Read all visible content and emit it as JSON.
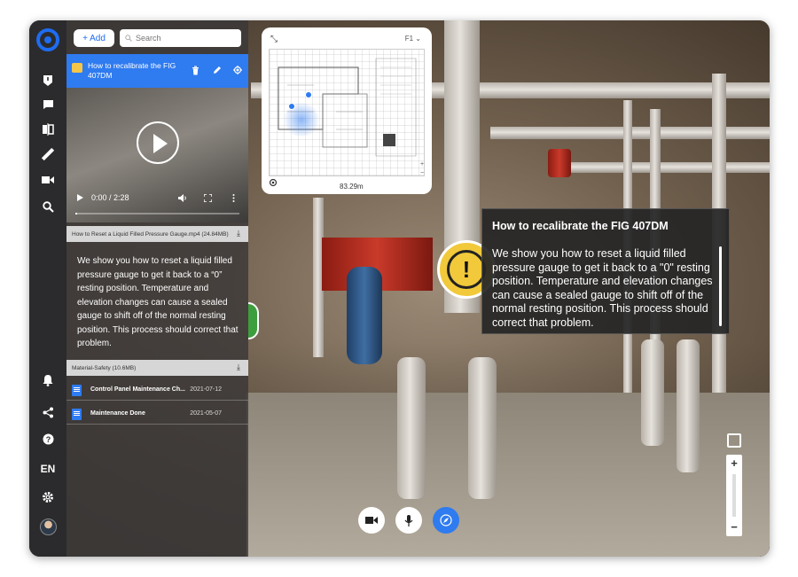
{
  "sidebar": {
    "icons": [
      "tag-icon",
      "comment-icon",
      "compare-icon",
      "measure-icon",
      "video-icon",
      "search-icon",
      "bell-icon",
      "share-icon",
      "help-icon",
      "settings-icon"
    ],
    "language": "EN"
  },
  "panel": {
    "add_label": "+ Add",
    "search_placeholder": "Search",
    "selected_tag_title": "How to recalibrate the FIG 407DM",
    "video": {
      "time": "0:00 / 2:28",
      "progress_fraction": 0.0
    },
    "video_file": "How to Reset a Liquid Filled Pressure Gauge.mp4 (24.84MB)",
    "description": "We show you how to reset a liquid filled pressure gauge to get it back to a “0” resting position. Temperature and elevation changes can cause a sealed gauge to shift off of the normal resting position. This process should correct that problem.",
    "attachment_file": "Material-Safety (10.6MB)",
    "documents": [
      {
        "name": "Control Panel Maintenance Ch...",
        "date": "2021-07-12"
      },
      {
        "name": "Maintenance Done",
        "date": "2021-05-07"
      }
    ]
  },
  "minimap": {
    "floor": "F1",
    "scale": "83.29m"
  },
  "tooltip": {
    "title": "How to recalibrate the FIG 407DM",
    "body": "We show you how to reset a liquid filled pressure gauge to get it back to a \"0\" resting position. Temperature and elevation changes can cause a sealed gauge to shift off of the normal resting position. This process should correct that problem."
  },
  "colors": {
    "accent": "#2f7bf0",
    "tag_warning": "#f1c93a",
    "tag_ok": "#3d9e3d"
  }
}
